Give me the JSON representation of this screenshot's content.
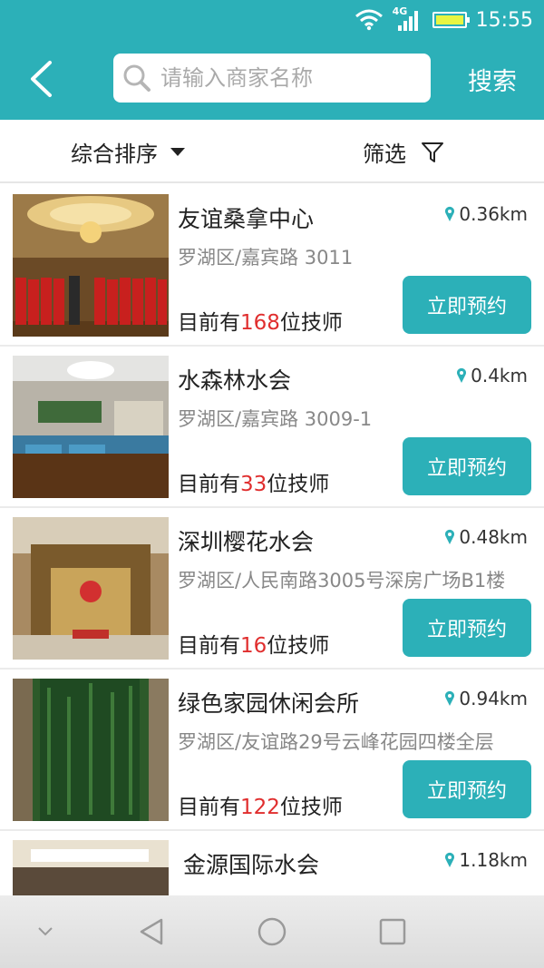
{
  "status": {
    "network": "4G",
    "time": "15:55"
  },
  "header": {
    "search_placeholder": "请输入商家名称",
    "search_button": "搜索"
  },
  "filters": {
    "sort_label": "综合排序",
    "filter_label": "筛选"
  },
  "merchants": [
    {
      "name": "友谊桑拿中心",
      "distance": "0.36km",
      "address": "罗湖区/嘉宾路 3011",
      "tech_prefix": "目前有",
      "tech_count": "168",
      "tech_suffix": "位技师",
      "book_label": "立即预约"
    },
    {
      "name": "水森林水会",
      "distance": "0.4km",
      "address": "罗湖区/嘉宾路 3009-1",
      "tech_prefix": "目前有",
      "tech_count": "33",
      "tech_suffix": "位技师",
      "book_label": "立即预约"
    },
    {
      "name": "深圳樱花水会",
      "distance": "0.48km",
      "address": "罗湖区/人民南路3005号深房广场B1楼",
      "tech_prefix": "目前有",
      "tech_count": "16",
      "tech_suffix": "位技师",
      "book_label": "立即预约"
    },
    {
      "name": "绿色家园休闲会所",
      "distance": "0.94km",
      "address": "罗湖区/友谊路29号云峰花园四楼全层",
      "tech_prefix": "目前有",
      "tech_count": "122",
      "tech_suffix": "位技师",
      "book_label": "立即预约"
    },
    {
      "name": "金源国际水会",
      "distance": "1.18km"
    }
  ],
  "colors": {
    "accent": "#2cb0b8",
    "highlight": "#e02e2e"
  }
}
